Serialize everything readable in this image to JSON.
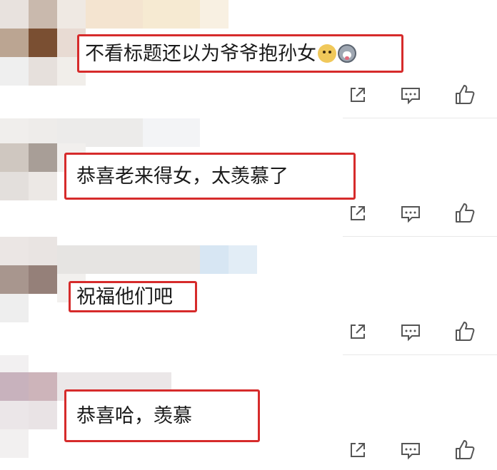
{
  "comments": [
    {
      "text": "不看标题还以为爷爷抱孙女",
      "emojis": [
        "doge-emoji",
        "husky-emoji"
      ]
    },
    {
      "text": "恭喜老来得女，太羡慕了"
    },
    {
      "text": "祝福他们吧"
    },
    {
      "text": "恭喜哈，羡慕"
    }
  ],
  "actions": [
    "share-icon",
    "reply-icon",
    "like-icon"
  ],
  "colors": {
    "highlight_border": "#d62b2b",
    "icon": "#555555",
    "divider": "#e8e8e8"
  }
}
